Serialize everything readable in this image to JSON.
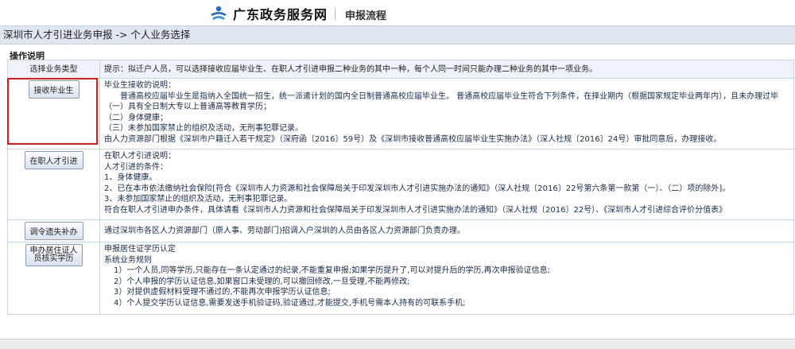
{
  "header": {
    "site_name": "广东政务服务网",
    "flow_label": "申报流程"
  },
  "breadcrumb": "深圳市人才引进业务申报 -> 个人业务选择",
  "section_title": "操作说明",
  "table": {
    "header_left": "选择业务类型",
    "header_right": "提示：拟迁户人员，可以选择接收应届毕业生、在职人才引进申报二种业务的其中一种，每个人同一时间只能办理二种业务的其中一项业务。",
    "rows": [
      {
        "button": "接收毕业生",
        "lines": [
          "毕业生接收的说明：",
          "普通高校应届毕业生是指纳入全国统一招生，统一派遣计划的国内全日制普通高校应届毕业生。  普通高校应届毕业生符合下列条件，在择业期内（根据国家规定毕业两年内），且未办理过毕",
          "（一）具有全日制大专以上普通高等教育学历；",
          "（二）身体健康；",
          "（三）未参加国家禁止的组织及活动，无刑事犯罪记录。",
          "由人力资源部门根据《深圳市户籍迁入若干规定》（深府函〔2016〕59号）及《深圳市接收普通高校应届毕业生实施办法》（深人社规〔2016〕24号）审批同意后，办理接收。"
        ]
      },
      {
        "button": "在职人才引进",
        "lines": [
          "在职人才引进说明：",
          "人才引进的条件：",
          "1、身体健康。",
          "2、已在本市依法缴纳社会保险[符合《深圳市人力资源和社会保障局关于印发深圳市人才引进实施办法的通知》（深人社规〔2016〕22号第六条第一款第（一）、（二）项的除外]。",
          "3、未参加国家禁止的组织及活动，无刑事犯罪记录。",
          "符合在职人才引进申办条件，具体请看《深圳市人力资源和社会保障局关于印发深圳市人才引进实施办法的通知》（深人社规〔2016〕22号）、《深圳市人才引进综合评价分值表》"
        ]
      },
      {
        "button": "调令遗失补办",
        "lines": [
          "通过深圳市各区人力资源部门（原人事、劳动部门)招调入户深圳的人员由各区人力资源部门负责办理。"
        ]
      },
      {
        "button": "申办居住证人员核实学历",
        "lines": [
          "申报居住证学历认定",
          "系统业务规则",
          "1）一个人员,同等学历,只能存在一条认定通过的纪录,不能重复申报;如果学历提升了,可以对提升后的学历,再次申报验证信息;",
          "2）个人申报的学历认证信息,如果窗口未受理的,可以撤回修改,一旦受理,不能再修改;",
          "3）对提供虚假材料受理不通过的,不能再次申报学历认证信息;",
          "4）个人提交学历认证信息,需要发送手机验证码,验证通过,才能提交,手机号需本人持有的可联系手机;"
        ]
      }
    ]
  }
}
